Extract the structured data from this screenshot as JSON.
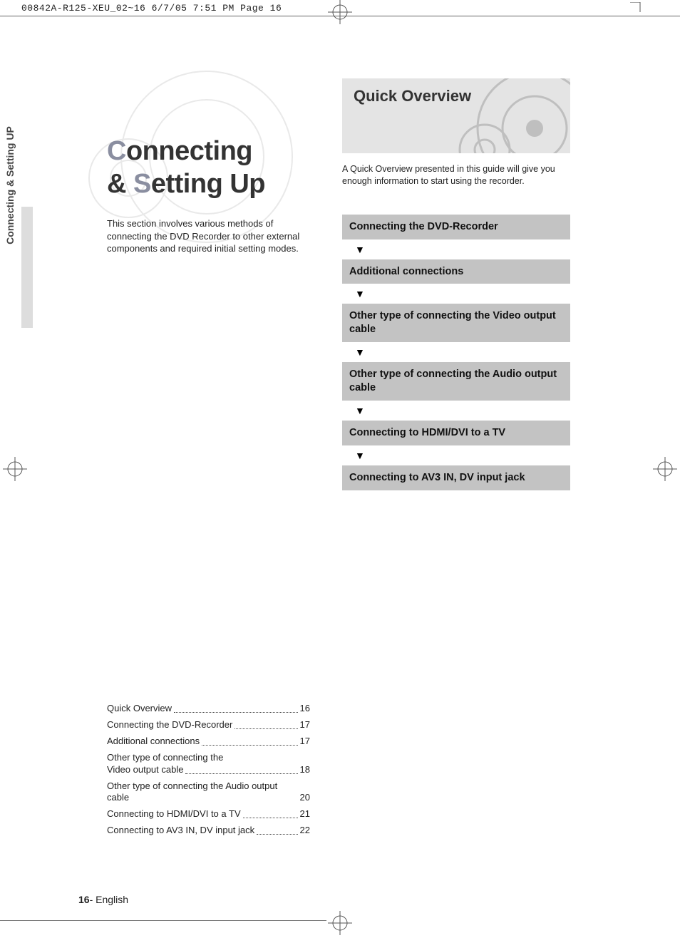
{
  "header": {
    "slug": "00842A-R125-XEU_02~16  6/7/05  7:51 PM  Page 16"
  },
  "sidebar": {
    "label": "Connecting & Setting UP"
  },
  "title": {
    "c1": "C",
    "w1": "onnecting",
    "amp": "& ",
    "c2": "S",
    "w2": "etting Up"
  },
  "intro": "This section involves various methods of connecting the DVD Recorder to other external components and required initial setting modes.",
  "quick": {
    "title": "Quick Overview",
    "desc": "A Quick Overview presented in this guide will give you enough information to start using the recorder."
  },
  "steps": [
    "Connecting the DVD-Recorder",
    "Additional connections",
    "Other type of connecting the Video output cable",
    "Other type of connecting the Audio output cable",
    "Connecting to HDMI/DVI to a TV",
    "Connecting to AV3 IN, DV input jack"
  ],
  "arrow": "▼",
  "toc": [
    {
      "label": "Quick Overview",
      "page": "16"
    },
    {
      "label": "Connecting the DVD-Recorder",
      "page": "17"
    },
    {
      "label": "Additional connections",
      "page": "17"
    },
    {
      "label": "Other type of connecting the",
      "label2": "Video output cable",
      "page": "18"
    },
    {
      "label": "Other type of connecting the Audio output cable",
      "page": "20"
    },
    {
      "label": "Connecting to HDMI/DVI to a TV",
      "page": "21"
    },
    {
      "label": "Connecting to AV3 IN, DV input jack",
      "page": "22"
    }
  ],
  "footer": {
    "page": "16",
    "sep": "- ",
    "lang": "English"
  }
}
